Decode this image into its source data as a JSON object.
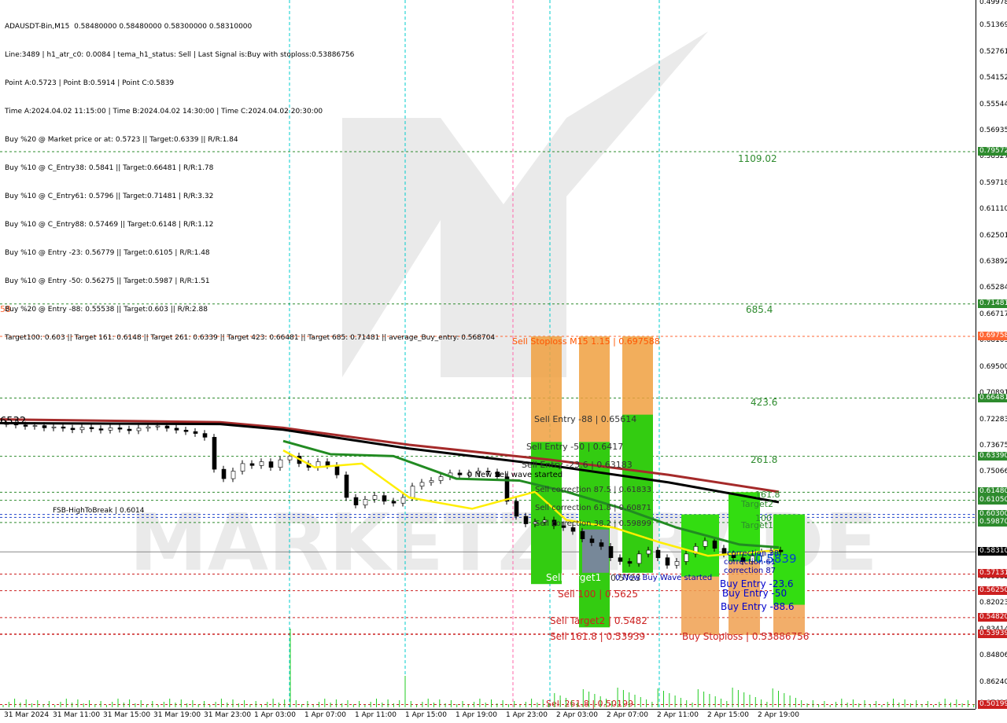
{
  "info": {
    "lines": [
      "ADAUSDT-Bin,M15  0.58480000 0.58480000 0.58300000 0.58310000",
      "Line:3489 | h1_atr_c0: 0.0084 | tema_h1_status: Sell | Last Signal is:Buy with stoploss:0.53886756",
      "Point A:0.5723 | Point B:0.5914 | Point C:0.5839",
      "Time A:2024.04.02 11:15:00 | Time B:2024.04.02 14:30:00 | Time C:2024.04.02 20:30:00",
      "Buy %20 @ Market price or at: 0.5723 || Target:0.6339 || R/R:1.84",
      "Buy %10 @ C_Entry38: 0.5841 || Target:0.66481 | R/R:1.78",
      "Buy %10 @ C_Entry61: 0.5796 || Target:0.71481 | R/R:3.32",
      "Buy %10 @ C_Entry88: 0.57469 || Target:0.6148 | R/R:1.12",
      "Buy %10 @ Entry -23: 0.56779 || Target:0.6105 | R/R:1.48",
      "Buy %10 @ Entry -50: 0.56275 || Target:0.5987 | R/R:1.51",
      "Buy %20 @ Entry -88: 0.55538 || Target:0.603 || R/R:2.88",
      "Target100: 0.603 || Target 161: 0.6148 || Target 261: 0.6339 || Target 423: 0.66481 || Target 685: 0.71481 || average_Buy_entry: 0.568704"
    ]
  },
  "watermark": "MARKETZITRADE",
  "colors": {
    "green_level": "#2e8b2e",
    "red_level": "#cc2020",
    "sell_zone_orange": "#f0a040",
    "sell_zone_green": "#33cc11",
    "buy_zone_orange": "#f0a050",
    "buy_zone_green": "#33dd11",
    "ma_red": "#a52a2a",
    "ma_black": "#000000",
    "ma_green": "#228b22",
    "ma_yellow": "#ffee00",
    "vline_cyan": "#00cccc",
    "vline_pink": "#ff66aa"
  },
  "labels": {
    "t1109": "1109.02",
    "t685": "685.4",
    "t423": "423.6",
    "t261": "261.8",
    "left_58": "58",
    "left_6532": "6532",
    "fsb": "FSB-HighToBreak | 0.6014",
    "sell_stoploss": "Sell Stoploss M15 1.15 | 0.697588",
    "sell_entry_88": "Sell Entry -88 | 0.65614",
    "sell_entry_50": "Sell Entry -50 | 0.6417",
    "sell_entry_23": "Sell Entry -23.6 | 0.63183",
    "sell_corr_875": "Sell correction 87.5 | 0.61833",
    "sell_corr_618": "Sell correction 61.8 | 0.60871",
    "sell_corr_382": "Sell correction 38.2 | 0.59899",
    "new_sell_wave": "0 New Sell wave started",
    "sell_target1": "Sell Target1",
    "new_buy_wave": "0 New Buy Wave started",
    "sell_100": "Sell 100 | 0.5625",
    "sell_target2": "Sell Target2 | 0.5482",
    "sell_1618": "Sell 161.8 | 0.53939",
    "sell_2618": "Sell 261.8 | 0.50199",
    "buy_corr_38": "correction 38",
    "buy_corr_61": "correction 61",
    "buy_corr_87": "correction 87",
    "buy_entry_236": "Buy Entry -23.6",
    "buy_entry_50": "Buy Entry -50",
    "buy_entry_886": "Buy Entry -88.6",
    "buy_stoploss": "Buy Stoploss | 0.53886756",
    "price_0_5839": "0.5839",
    "target1": "Target1",
    "target2": "Target2",
    "t100": "100",
    "t161": "161.8",
    "sell_target1_price": "0.5723"
  },
  "price_tags": [
    {
      "text": "0.79572",
      "color": "#2e8b2e",
      "price": 0.79572
    },
    {
      "text": "0.71481",
      "color": "#2e8b2e",
      "price": 0.71481
    },
    {
      "text": "0.69758",
      "color": "#ff6633",
      "price": 0.69758
    },
    {
      "text": "0.66481",
      "color": "#2e8b2e",
      "price": 0.66481
    },
    {
      "text": "0.63390",
      "color": "#2e8b2e",
      "price": 0.6339
    },
    {
      "text": "0.61480",
      "color": "#2e8b2e",
      "price": 0.6148
    },
    {
      "text": "0.61050",
      "color": "#2e8b2e",
      "price": 0.6105
    },
    {
      "text": "0.60300",
      "color": "#2e8b2e",
      "price": 0.603
    },
    {
      "text": "0.59870",
      "color": "#2e8b2e",
      "price": 0.5987
    },
    {
      "text": "0.58310",
      "color": "#000000",
      "price": 0.5831
    },
    {
      "text": "0.57131",
      "color": "#cc2020",
      "price": 0.57131
    },
    {
      "text": "0.56250",
      "color": "#cc2020",
      "price": 0.5625
    },
    {
      "text": "0.54820",
      "color": "#cc2020",
      "price": 0.5482
    },
    {
      "text": "0.53939",
      "color": "#cc2020",
      "price": 0.53939
    },
    {
      "text": "0.50199",
      "color": "#cc2020",
      "price": 0.50199
    }
  ],
  "chart_data": {
    "type": "candlestick",
    "symbol": "ADAUSDT-Bin",
    "timeframe": "M15",
    "ylim": [
      0.4997,
      0.8763
    ],
    "y_ticks": [
      "0.87631",
      "0.86240",
      "0.84806",
      "0.83414",
      "0.82023",
      "0.80632",
      "0.79240",
      "0.77849",
      "0.76457",
      "0.75066",
      "0.73675",
      "0.72283",
      "0.70891",
      "0.69500",
      "0.68109",
      "0.66717",
      "0.65284",
      "0.63892",
      "0.62501",
      "0.61110",
      "0.59718",
      "0.58327",
      "0.56935",
      "0.55544",
      "0.54152",
      "0.52761",
      "0.51369",
      "0.49978"
    ],
    "x_ticks": [
      "31 Mar 2024",
      "31 Mar 11:00",
      "31 Mar 15:00",
      "31 Mar 19:00",
      "31 Mar 23:00",
      "1 Apr 03:00",
      "1 Apr 07:00",
      "1 Apr 11:00",
      "1 Apr 15:00",
      "1 Apr 19:00",
      "1 Apr 23:00",
      "2 Apr 03:00",
      "2 Apr 07:00",
      "2 Apr 11:00",
      "2 Apr 15:00",
      "2 Apr 19:00"
    ],
    "levels": [
      {
        "price": 0.79572,
        "color": "green"
      },
      {
        "price": 0.71481,
        "color": "green"
      },
      {
        "price": 0.69758,
        "color": "orange"
      },
      {
        "price": 0.66481,
        "color": "green"
      },
      {
        "price": 0.6339,
        "color": "green"
      },
      {
        "price": 0.6148,
        "color": "green"
      },
      {
        "price": 0.6105,
        "color": "green"
      },
      {
        "price": 0.603,
        "color": "blue"
      },
      {
        "price": 0.6014,
        "color": "blue"
      },
      {
        "price": 0.5987,
        "color": "green"
      },
      {
        "price": 0.5831,
        "color": "gray"
      },
      {
        "price": 0.57131,
        "color": "red"
      },
      {
        "price": 0.5625,
        "color": "red"
      },
      {
        "price": 0.5482,
        "color": "red"
      },
      {
        "price": 0.53939,
        "color": "red"
      },
      {
        "price": 0.50199,
        "color": "red"
      }
    ],
    "close_series": [
      0.6512,
      0.6505,
      0.6498,
      0.6502,
      0.649,
      0.6495,
      0.6488,
      0.648,
      0.6492,
      0.6485,
      0.6478,
      0.649,
      0.6483,
      0.6475,
      0.6488,
      0.6495,
      0.65,
      0.6488,
      0.6478,
      0.647,
      0.646,
      0.644,
      0.627,
      0.622,
      0.626,
      0.63,
      0.629,
      0.631,
      0.628,
      0.632,
      0.634,
      0.63,
      0.628,
      0.631,
      0.629,
      0.624,
      0.612,
      0.608,
      0.611,
      0.613,
      0.61,
      0.609,
      0.612,
      0.618,
      0.62,
      0.621,
      0.623,
      0.625,
      0.624,
      0.625,
      0.626,
      0.6255,
      0.623,
      0.61,
      0.602,
      0.598,
      0.599,
      0.6,
      0.597,
      0.596,
      0.594,
      0.59,
      0.588,
      0.586,
      0.58,
      0.578,
      0.577,
      0.582,
      0.584,
      0.58,
      0.576,
      0.578,
      0.582,
      0.586,
      0.589,
      0.585,
      0.582,
      0.58,
      0.578,
      0.581,
      0.583,
      0.584,
      0.5831
    ]
  }
}
